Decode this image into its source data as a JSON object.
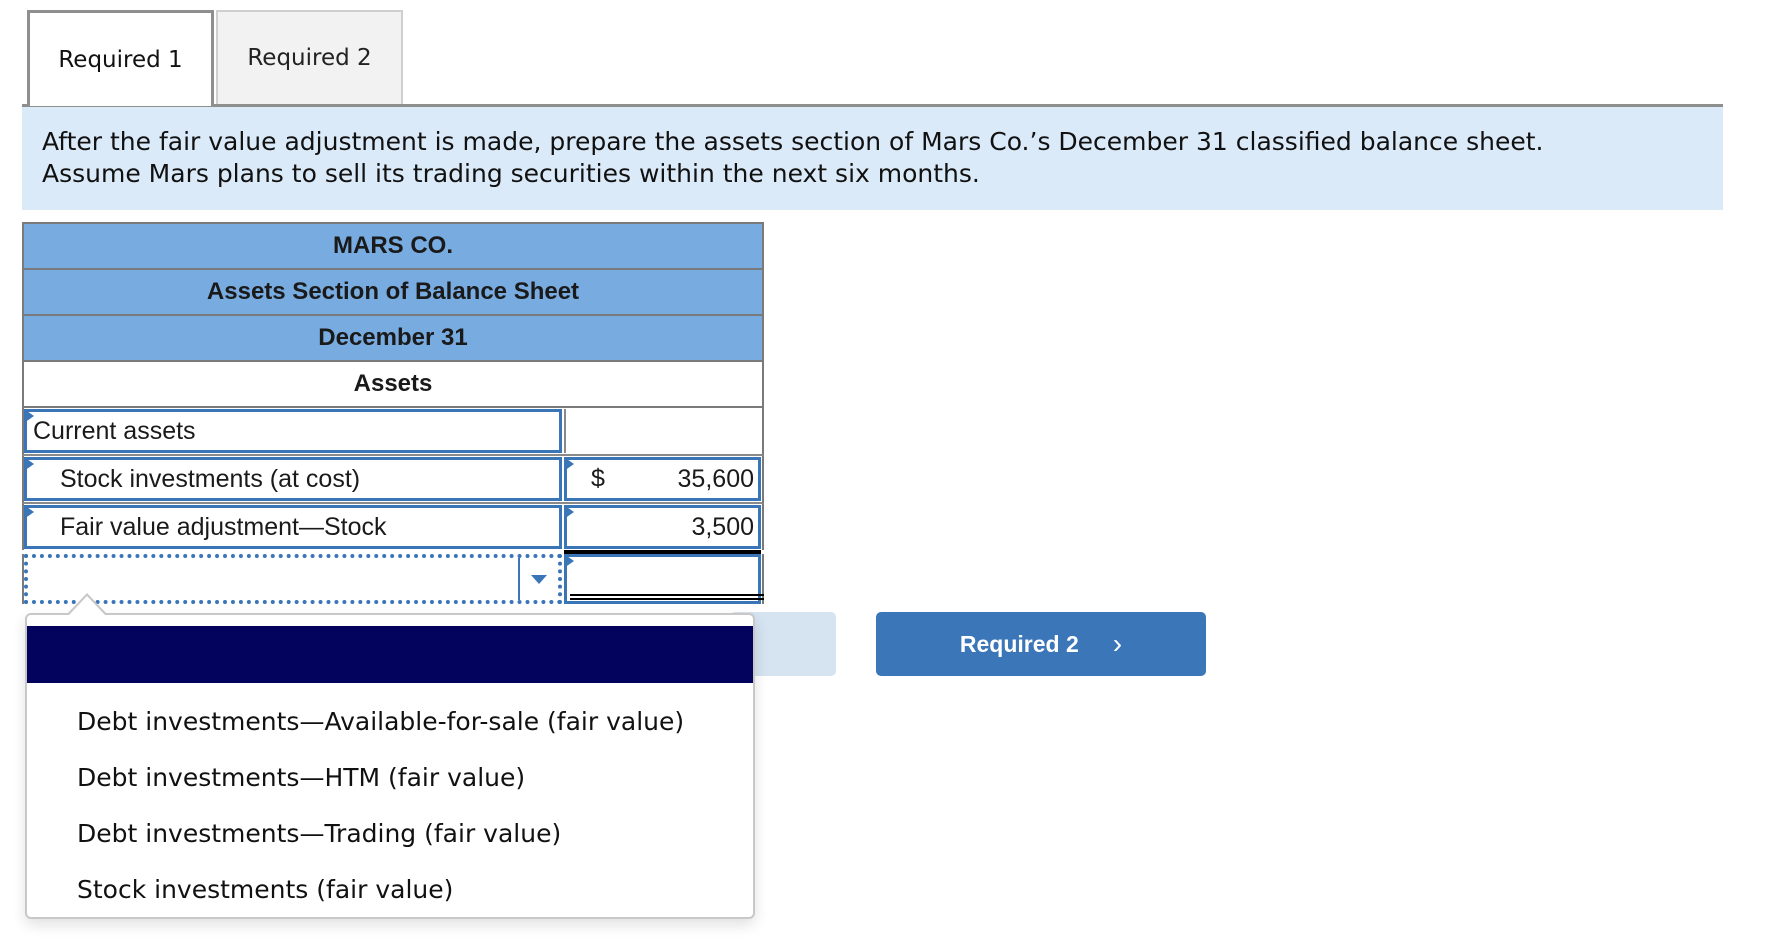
{
  "tabs": [
    {
      "label": "Required 1",
      "active": true
    },
    {
      "label": "Required 2",
      "active": false
    }
  ],
  "instructions": {
    "line1": "After the fair value adjustment is made, prepare the assets section of Mars Co.’s December 31 classified balance sheet.",
    "line2": "Assume Mars plans to sell its trading securities within the next six months."
  },
  "sheet": {
    "company": "MARS CO.",
    "title": "Assets Section of Balance Sheet",
    "date": "December 31",
    "section": "Assets",
    "rows": [
      {
        "label": "Current assets",
        "currency": "",
        "value": ""
      },
      {
        "label": "Stock investments (at cost)",
        "currency": "$",
        "value": "35,600"
      },
      {
        "label": "Fair value adjustment—Stock",
        "currency": "",
        "value": "3,500"
      },
      {
        "label": "",
        "currency": "",
        "value": ""
      }
    ]
  },
  "dropdown": {
    "selected": "",
    "options": [
      "Debt investments—Available-for-sale (fair value)",
      "Debt investments—HTM (fair value)",
      "Debt investments—Trading (fair value)",
      "Stock investments (fair value)"
    ]
  },
  "nav": {
    "next_label": "Required 2",
    "next_icon": "chevron-right-icon",
    "next_glyph": "›"
  },
  "colors": {
    "header_blue": "#78abe0",
    "instruction_bg": "#dbeaf8",
    "input_border": "#3a75b8",
    "selected_option": "#03035e",
    "next_button": "#3a76b8"
  }
}
